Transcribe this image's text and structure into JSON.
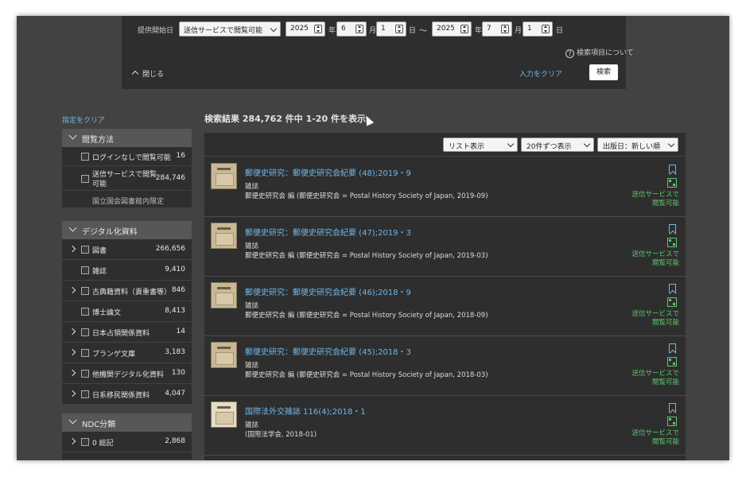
{
  "search_panel": {
    "start_label": "提供開始日",
    "scope_select": "送信サービスで閲覧可能",
    "from": {
      "year": "2025",
      "month": "6",
      "day": "1"
    },
    "to": {
      "year": "2025",
      "month": "7",
      "day": "1"
    },
    "unit_year": "年",
    "unit_month": "月",
    "unit_day": "日",
    "range_sep": "〜",
    "help_text": "検索項目について",
    "close_label": "閉じる",
    "clear_input": "入力をクリア",
    "search_button": "検索"
  },
  "sidebar": {
    "clear_filter": "指定をクリア",
    "access": {
      "title": "閲覧方法",
      "items": [
        {
          "label": "ログインなしで閲覧可能",
          "count": "16"
        },
        {
          "label1": "送信サービスで閲覧",
          "label2": "可能",
          "count": "284,746"
        }
      ],
      "note": "国立国会図書館内限定"
    },
    "digital": {
      "title": "デジタル化資料",
      "items": [
        {
          "label": "図書",
          "count": "266,656"
        },
        {
          "label": "雑誌",
          "count": "9,410"
        },
        {
          "label": "古典籍資料（貴重書等）",
          "count": "846"
        },
        {
          "label": "博士論文",
          "count": "8,413"
        },
        {
          "label": "日本占領関係資料",
          "count": "14"
        },
        {
          "label": "プランゲ文庫",
          "count": "3,183"
        },
        {
          "label": "他機関デジタル化資料",
          "count": "130"
        },
        {
          "label": "日系移民関係資料",
          "count": "4,047"
        }
      ]
    },
    "ndc": {
      "title": "NDC分類",
      "items": [
        {
          "label": "0 総記",
          "count": "2,868"
        }
      ]
    }
  },
  "results": {
    "summary": "検索結果 284,762 件中 1-20 件を表示",
    "view_select": "リスト表示",
    "per_page_select": "20件ずつ表示",
    "sort_select": "出版日：新しい順",
    "items": [
      {
        "title": "郵便史研究：郵便史研究会紀要 (48);2019・9",
        "type": "雑誌",
        "author": "郵便史研究会 編 (郵便史研究会 = Postal History Society of Japan, 2019-09)",
        "avail1": "送信サービスで",
        "avail2": "閲覧可能"
      },
      {
        "title": "郵便史研究：郵便史研究会紀要 (47);2019・3",
        "type": "雑誌",
        "author": "郵便史研究会 編 (郵便史研究会 = Postal History Society of Japan, 2019-03)",
        "avail1": "送信サービスで",
        "avail2": "閲覧可能"
      },
      {
        "title": "郵便史研究：郵便史研究会紀要 (46);2018・9",
        "type": "雑誌",
        "author": "郵便史研究会 編 (郵便史研究会 = Postal History Society of Japan, 2018-09)",
        "avail1": "送信サービスで",
        "avail2": "閲覧可能"
      },
      {
        "title": "郵便史研究：郵便史研究会紀要 (45);2018・3",
        "type": "雑誌",
        "author": "郵便史研究会 編 (郵便史研究会 = Postal History Society of Japan, 2018-03)",
        "avail1": "送信サービスで",
        "avail2": "閲覧可能"
      },
      {
        "title": "国際法外交雑誌 116(4);2018・1",
        "type": "雑誌",
        "author": "(国際法学会, 2018-01)",
        "avail1": "送信サービスで",
        "avail2": "閲覧可能"
      }
    ]
  }
}
